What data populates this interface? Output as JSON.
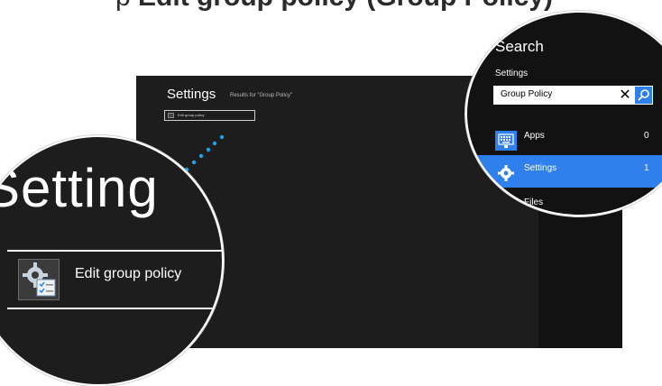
{
  "caption": {
    "prefix": "p",
    "bold": "Edit group policy (Group Policy)"
  },
  "screen": {
    "title": "Settings",
    "subtitle": "Results for \"Group Policy\"",
    "result_label": "Edit group policy"
  },
  "zoom_left": {
    "heading": "Setting",
    "result_label": "Edit group policy"
  },
  "zoom_right": {
    "heading": "Search",
    "scope": "Settings",
    "search_value": "Group Policy",
    "clear_glyph": "✕",
    "categories": [
      {
        "label": "Apps",
        "count": "0"
      },
      {
        "label": "Settings",
        "count": "1"
      },
      {
        "label": "Files",
        "count": ""
      }
    ]
  },
  "colors": {
    "accent": "#2f80ed",
    "screen_bg": "#1d1d1d",
    "charm_bg": "#121212",
    "connector": "#1aa3e8"
  },
  "icons": [
    "settings-gear-icon",
    "search-icon",
    "keyboard-icon",
    "gear-icon",
    "clear-icon",
    "file-icon"
  ]
}
